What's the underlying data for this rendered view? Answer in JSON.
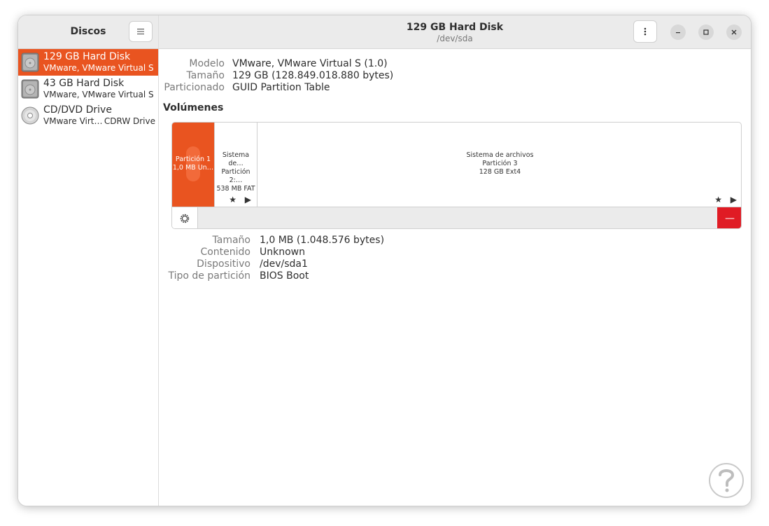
{
  "sidebar": {
    "title": "Discos",
    "menu_icon": "hamburger-icon",
    "disks": [
      {
        "title": "129 GB Hard Disk",
        "subtitle": "VMware, VMware Virtual S",
        "subtitle_right": "",
        "icon": "hard-disk-icon",
        "selected": true
      },
      {
        "title": "43 GB Hard Disk",
        "subtitle": "VMware, VMware Virtual S",
        "subtitle_right": "",
        "icon": "hard-disk-icon",
        "selected": false
      },
      {
        "title": "CD/DVD Drive",
        "subtitle": "VMware Virt…",
        "subtitle_right": "CDRW Drive",
        "icon": "optical-disc-icon",
        "selected": false
      }
    ]
  },
  "header": {
    "title": "129 GB Hard Disk",
    "subtitle": "/dev/sda",
    "menu_icon": "vertical-dots-icon"
  },
  "window_controls": {
    "minimize_label": "–",
    "maximize_label": "□",
    "close_label": "✕"
  },
  "disk_props": [
    {
      "label": "Modelo",
      "value": "VMware, VMware Virtual S (1.0)"
    },
    {
      "label": "Tamaño",
      "value": "129 GB (128.849.018.880 bytes)"
    },
    {
      "label": "Particionado",
      "value": "GUID Partition Table"
    }
  ],
  "volumes": {
    "title": "Volúmenes",
    "partitions": [
      {
        "line1": "Partición 1",
        "line2": "1,0 MB Un…",
        "line3": "",
        "selected": true
      },
      {
        "line1": "Sistema de…",
        "line2": "Partición 2:…",
        "line3": "538 MB FAT",
        "selected": false
      },
      {
        "line1": "Sistema de archivos",
        "line2": "Partición 3",
        "line3": "128 GB Ext4",
        "selected": false
      }
    ],
    "mini_icons": "★ ▶",
    "minus_label": "—"
  },
  "partition_props": [
    {
      "label": "Tamaño",
      "value": "1,0 MB (1.048.576 bytes)"
    },
    {
      "label": "Contenido",
      "value": "Unknown"
    },
    {
      "label": "Dispositivo",
      "value": "/dev/sda1"
    },
    {
      "label": "Tipo de partición",
      "value": "BIOS Boot"
    }
  ],
  "colors": {
    "accent": "#e95420",
    "destructive": "#e01b24",
    "header_bg": "#ebebeb"
  }
}
